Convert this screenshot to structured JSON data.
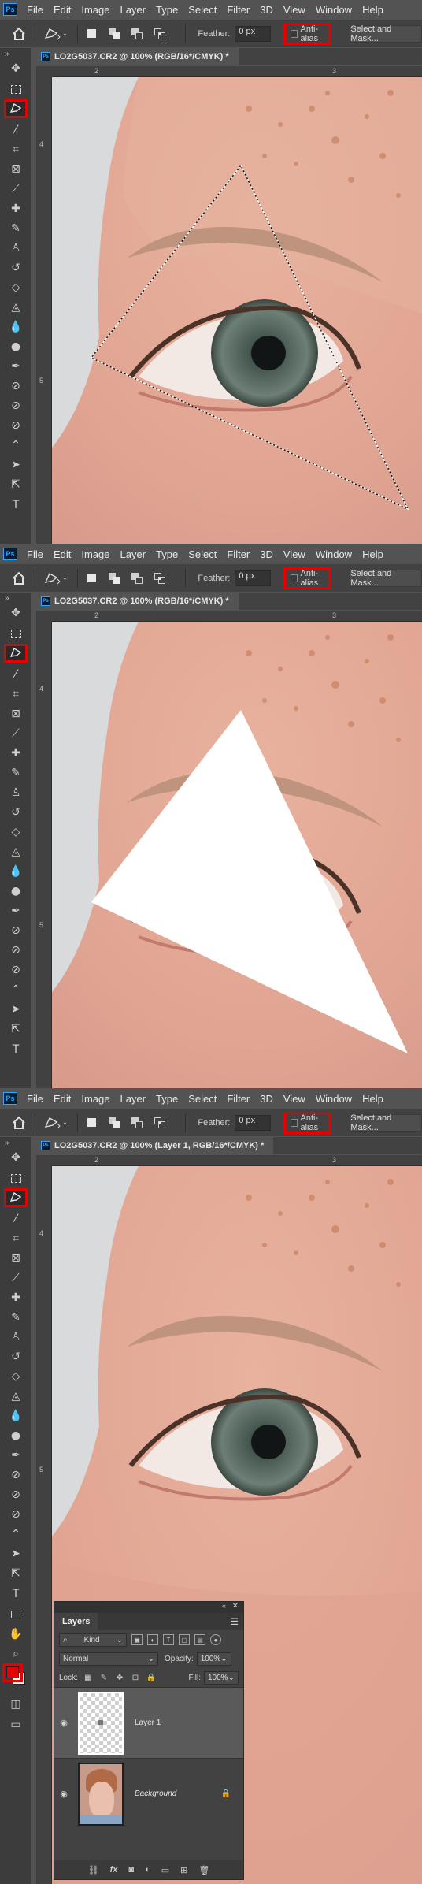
{
  "app": {
    "menu": [
      "File",
      "Edit",
      "Image",
      "Layer",
      "Type",
      "Select",
      "Filter",
      "3D",
      "View",
      "Window",
      "Help"
    ],
    "logo": "Ps"
  },
  "options": {
    "feather_label": "Feather:",
    "feather_value": "0 px",
    "antialias_label": "Anti-alias",
    "antialias_checked": false,
    "select_mask_label": "Select and Mask..."
  },
  "frames": [
    {
      "doc_title": "LO2G5037.CR2 @ 100% (RGB/16*/CMYK) *",
      "ruler_top": [
        "2",
        "3"
      ],
      "ruler_left": [
        "4",
        "5"
      ]
    },
    {
      "doc_title": "LO2G5037.CR2 @ 100% (RGB/16*/CMYK) *",
      "ruler_top": [
        "2",
        "3"
      ],
      "ruler_left": [
        "4",
        "5"
      ]
    },
    {
      "doc_title": "LO2G5037.CR2 @ 100% (Layer 1, RGB/16*/CMYK) *",
      "ruler_top": [
        "2",
        "3"
      ],
      "ruler_left": [
        "4",
        "5"
      ]
    }
  ],
  "tools": {
    "active": "polygonal-lasso",
    "highlight_color": "#e60000",
    "foreground_color": "#e60000",
    "background_color": "#ffffff"
  },
  "layers_panel": {
    "tab": "Layers",
    "kind_label": "Kind",
    "blend_mode": "Normal",
    "opacity_label": "Opacity:",
    "opacity_value": "100%",
    "lock_label": "Lock:",
    "fill_label": "Fill:",
    "fill_value": "100%",
    "layers": [
      {
        "name": "Layer 1",
        "selected": true,
        "locked": false
      },
      {
        "name": "Background",
        "selected": false,
        "locked": true
      }
    ],
    "footer_icons": [
      "link-icon",
      "fx-icon",
      "mask-icon",
      "adjustment-icon",
      "folder-icon",
      "new-layer-icon",
      "trash-icon"
    ]
  }
}
